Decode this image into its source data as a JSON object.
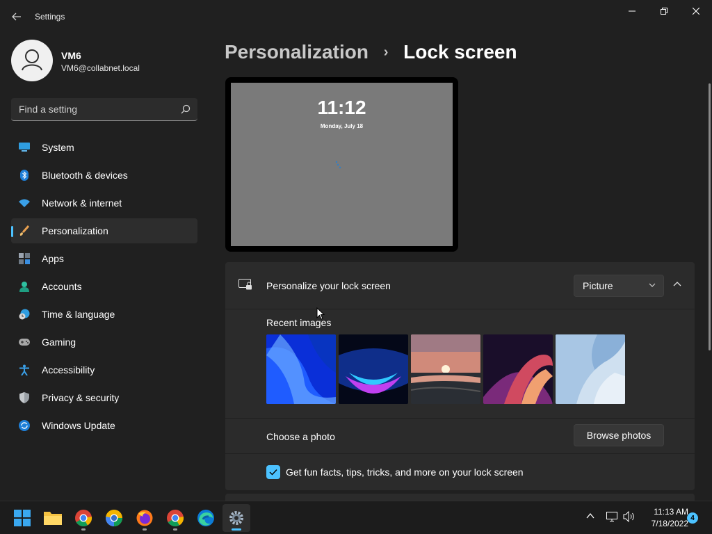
{
  "window": {
    "title": "Settings",
    "back_icon": "back-arrow-icon",
    "controls": [
      "minimize-icon",
      "restore-icon",
      "close-icon"
    ]
  },
  "profile": {
    "name": "VM6",
    "email": "VM6@collabnet.local"
  },
  "search": {
    "placeholder": "Find a setting",
    "icon": "search-icon"
  },
  "sidebar": {
    "items": [
      {
        "label": "System",
        "icon": "system-icon",
        "active": false
      },
      {
        "label": "Bluetooth & devices",
        "icon": "bluetooth-icon",
        "active": false
      },
      {
        "label": "Network & internet",
        "icon": "wifi-icon",
        "active": false
      },
      {
        "label": "Personalization",
        "icon": "brush-icon",
        "active": true
      },
      {
        "label": "Apps",
        "icon": "apps-icon",
        "active": false
      },
      {
        "label": "Accounts",
        "icon": "accounts-icon",
        "active": false
      },
      {
        "label": "Time & language",
        "icon": "clock-globe-icon",
        "active": false
      },
      {
        "label": "Gaming",
        "icon": "gamepad-icon",
        "active": false
      },
      {
        "label": "Accessibility",
        "icon": "accessibility-icon",
        "active": false
      },
      {
        "label": "Privacy & security",
        "icon": "shield-icon",
        "active": false
      },
      {
        "label": "Windows Update",
        "icon": "update-icon",
        "active": false
      }
    ]
  },
  "breadcrumb": {
    "parent": "Personalization",
    "separator": "›",
    "current": "Lock screen"
  },
  "preview": {
    "time": "11:12",
    "date": "Monday, July 18"
  },
  "personalize": {
    "title": "Personalize your lock screen",
    "icon": "lock-screen-icon",
    "dropdown_value": "Picture",
    "recent_label": "Recent images",
    "thumbnails": [
      "bloom-blue",
      "glow-dark",
      "sunset-lake",
      "ribbon-purple",
      "bloom-light"
    ]
  },
  "choose_photo": {
    "label": "Choose a photo",
    "button": "Browse photos"
  },
  "fun_facts": {
    "label": "Get fun facts, tips, tricks, and more on your lock screen",
    "checked": true
  },
  "taskbar": {
    "apps": [
      "start-icon",
      "file-explorer-icon",
      "chrome-icon",
      "chrome-alt-icon",
      "firefox-icon",
      "chrome-icon-2",
      "edge-icon",
      "settings-gear-icon"
    ],
    "tray_icons": [
      "tray-overflow-icon",
      "network-icon",
      "volume-icon"
    ],
    "time": "11:13 AM",
    "date": "7/18/2022",
    "notification_count": "4"
  },
  "colors": {
    "accent": "#4cc2ff",
    "background": "#202020",
    "card": "#2b2b2b",
    "taskbar": "#1c1c1c"
  }
}
